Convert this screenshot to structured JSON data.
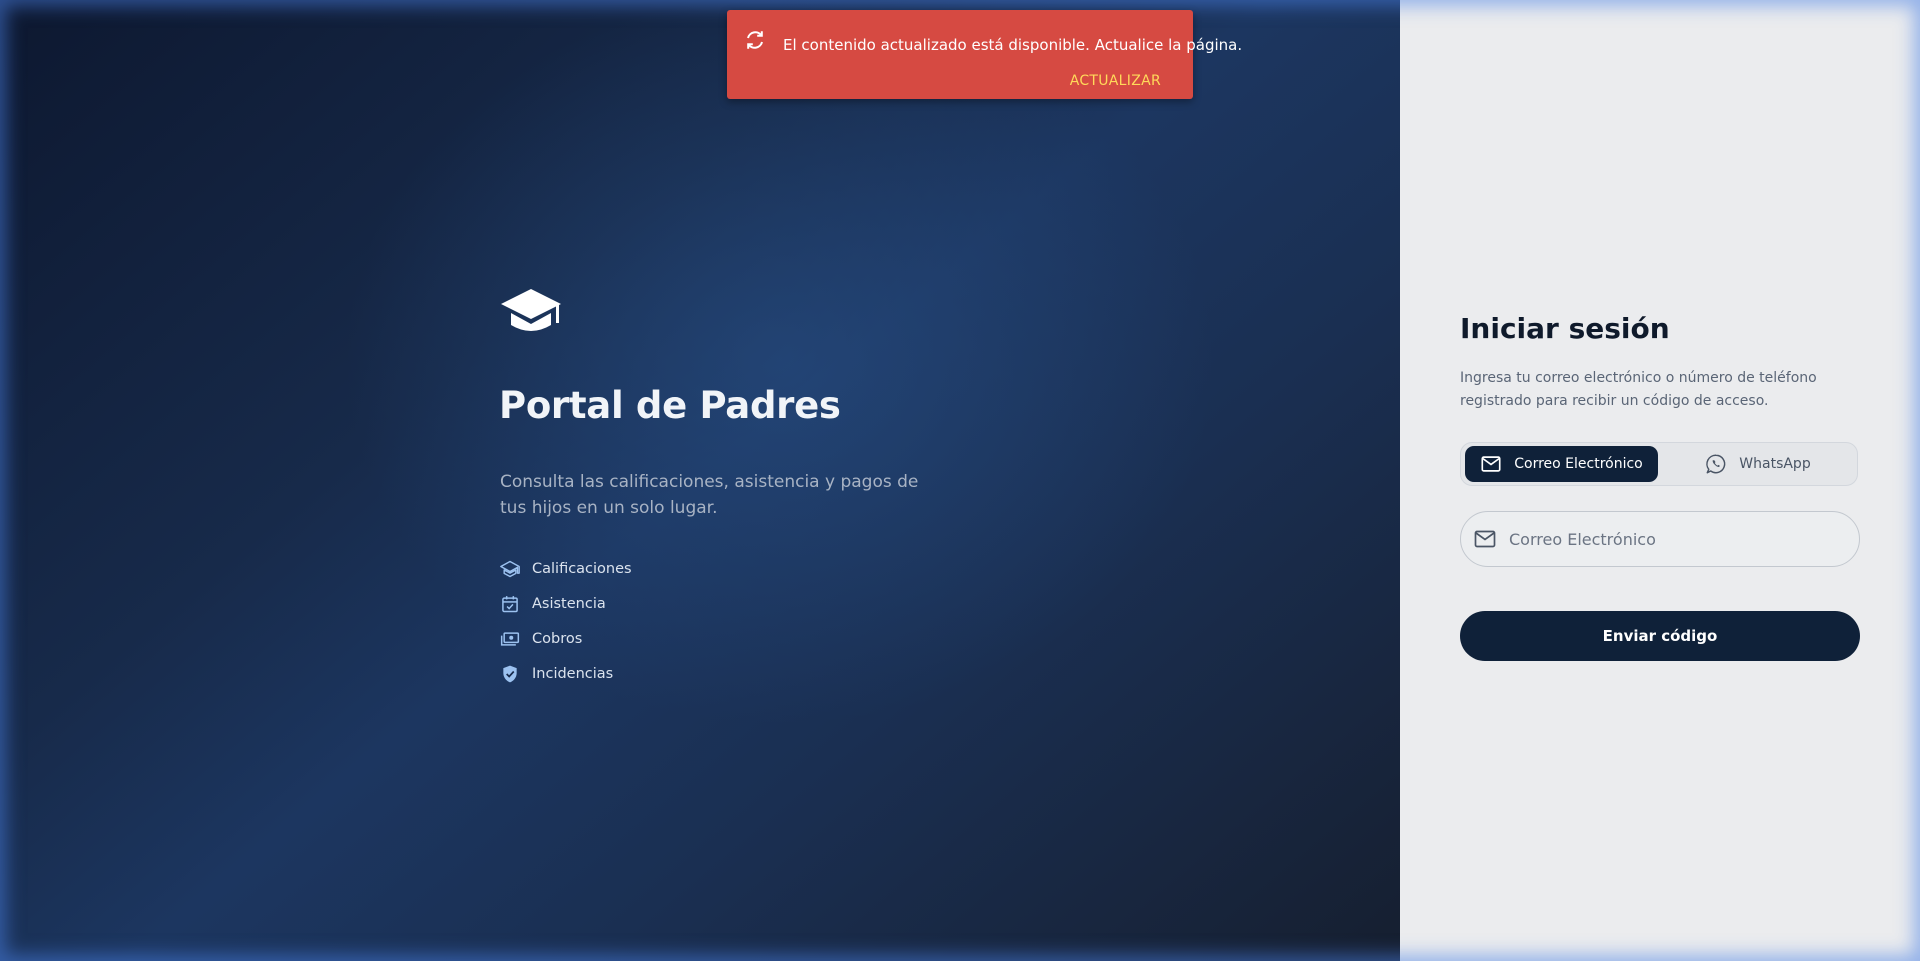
{
  "toast": {
    "message": "El contenido actualizado está disponible. Actualice la página.",
    "action_label": "ACTUALIZAR",
    "background_color": "#d64a42",
    "action_color": "#ffd95a"
  },
  "hero": {
    "logo_icon": "graduation-cap-icon",
    "title": "Portal de Padres",
    "description": "Consulta las calificaciones, asistencia y pagos de tus hijos en un solo lugar.",
    "features": [
      {
        "label": "Calificaciones",
        "icon": "school-icon"
      },
      {
        "label": "Asistencia",
        "icon": "calendar-check-icon"
      },
      {
        "label": "Cobros",
        "icon": "payments-icon"
      },
      {
        "label": "Incidencias",
        "icon": "shield-check-icon"
      }
    ]
  },
  "login": {
    "title": "Iniciar sesión",
    "subtitle": "Ingresa tu correo electrónico o número de teléfono registrado para recibir un código de acceso.",
    "method_options": [
      {
        "label": "Correo Electrónico",
        "icon": "mail-icon",
        "selected": true
      },
      {
        "label": "WhatsApp",
        "icon": "whatsapp-icon",
        "selected": false
      }
    ],
    "email_placeholder": "Correo Electrónico",
    "submit_label": "Enviar código"
  },
  "colors": {
    "primary_dark": "#0f2139",
    "panel_background": "#ebecee"
  }
}
